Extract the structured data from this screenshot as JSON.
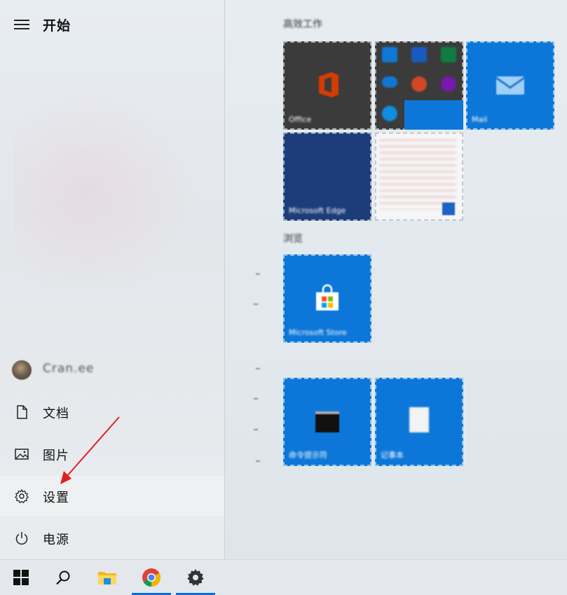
{
  "start": {
    "title": "开始",
    "user_name": "Cran.ee",
    "items": [
      {
        "label": "文档",
        "icon": "document-icon"
      },
      {
        "label": "图片",
        "icon": "pictures-icon"
      },
      {
        "label": "设置",
        "icon": "gear-icon"
      },
      {
        "label": "电源",
        "icon": "power-icon"
      }
    ]
  },
  "tiles": {
    "group1_header": "高效工作",
    "group2_header": "浏览",
    "office_label": "Office",
    "mail_label": "Mail",
    "edge_label": "Microsoft Edge",
    "photos_label": "",
    "store_label": "Microsoft Store",
    "terminal_label": "命令提示符",
    "notepad_label": "记事本"
  },
  "colors": {
    "tile_blue": "#0c77d8",
    "accent": "#0c6ed6",
    "annotation_red": "#e02020"
  }
}
